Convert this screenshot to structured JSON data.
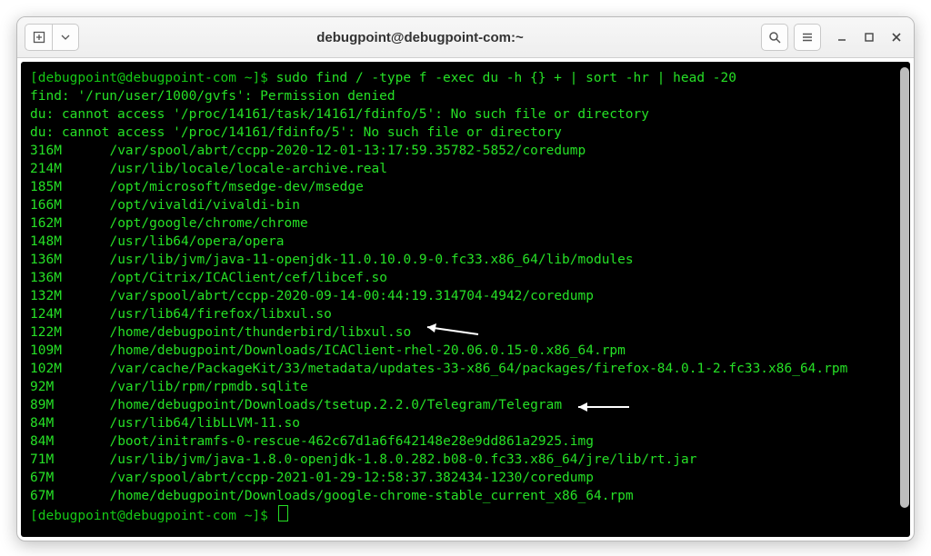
{
  "window": {
    "title": "debugpoint@debugpoint-com:~"
  },
  "prompt": {
    "open": "[",
    "userhost": "debugpoint@debugpoint-com ~",
    "close": "]$ "
  },
  "command": "sudo find / -type f -exec du -h {} + | sort -hr | head -20",
  "errors": [
    "find: '/run/user/1000/gvfs': Permission denied",
    "du: cannot access '/proc/14161/task/14161/fdinfo/5': No such file or directory",
    "du: cannot access '/proc/14161/fdinfo/5': No such file or directory"
  ],
  "rows": [
    {
      "size": "316M",
      "path": "/var/spool/abrt/ccpp-2020-12-01-13:17:59.35782-5852/coredump"
    },
    {
      "size": "214M",
      "path": "/usr/lib/locale/locale-archive.real"
    },
    {
      "size": "185M",
      "path": "/opt/microsoft/msedge-dev/msedge"
    },
    {
      "size": "166M",
      "path": "/opt/vivaldi/vivaldi-bin"
    },
    {
      "size": "162M",
      "path": "/opt/google/chrome/chrome"
    },
    {
      "size": "148M",
      "path": "/usr/lib64/opera/opera"
    },
    {
      "size": "136M",
      "path": "/usr/lib/jvm/java-11-openjdk-11.0.10.0.9-0.fc33.x86_64/lib/modules"
    },
    {
      "size": "136M",
      "path": "/opt/Citrix/ICAClient/cef/libcef.so"
    },
    {
      "size": "132M",
      "path": "/var/spool/abrt/ccpp-2020-09-14-00:44:19.314704-4942/coredump"
    },
    {
      "size": "124M",
      "path": "/usr/lib64/firefox/libxul.so"
    },
    {
      "size": "122M",
      "path": "/home/debugpoint/thunderbird/libxul.so"
    },
    {
      "size": "109M",
      "path": "/home/debugpoint/Downloads/ICAClient-rhel-20.06.0.15-0.x86_64.rpm"
    },
    {
      "size": "102M",
      "path": "/var/cache/PackageKit/33/metadata/updates-33-x86_64/packages/firefox-84.0.1-2.fc33.x86_64.rpm"
    },
    {
      "size": "92M",
      "path": "/var/lib/rpm/rpmdb.sqlite"
    },
    {
      "size": "89M",
      "path": "/home/debugpoint/Downloads/tsetup.2.2.0/Telegram/Telegram"
    },
    {
      "size": "84M",
      "path": "/usr/lib64/libLLVM-11.so"
    },
    {
      "size": "84M",
      "path": "/boot/initramfs-0-rescue-462c67d1a6f642148e28e9dd861a2925.img"
    },
    {
      "size": "71M",
      "path": "/usr/lib/jvm/java-1.8.0-openjdk-1.8.0.282.b08-0.fc33.x86_64/jre/lib/rt.jar"
    },
    {
      "size": "67M",
      "path": "/var/spool/abrt/ccpp-2021-01-29-12:58:37.382434-1230/coredump"
    },
    {
      "size": "67M",
      "path": "/home/debugpoint/Downloads/google-chrome-stable_current_x86_64.rpm"
    }
  ],
  "annotations": {
    "arrow1_row_index": 10,
    "arrow2_row_index": 14
  }
}
